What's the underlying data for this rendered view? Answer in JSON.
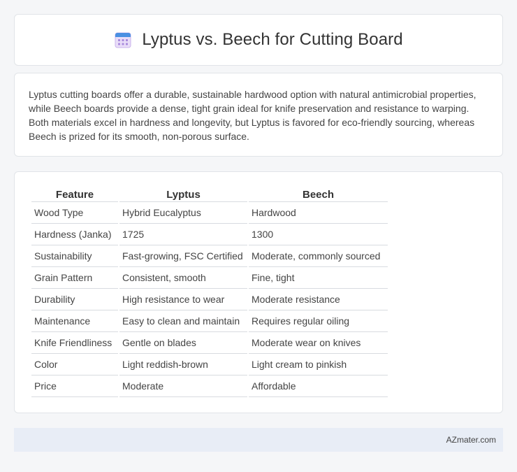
{
  "header": {
    "title": "Lyptus vs. Beech for Cutting Board",
    "icon": "calendar-icon"
  },
  "summary": {
    "text": "Lyptus cutting boards offer a durable, sustainable hardwood option with natural antimicrobial properties, while Beech boards provide a dense, tight grain ideal for knife preservation and resistance to warping. Both materials excel in hardness and longevity, but Lyptus is favored for eco-friendly sourcing, whereas Beech is prized for its smooth, non-porous surface."
  },
  "table": {
    "headers": [
      "Feature",
      "Lyptus",
      "Beech"
    ],
    "rows": [
      [
        "Wood Type",
        "Hybrid Eucalyptus",
        "Hardwood"
      ],
      [
        "Hardness (Janka)",
        "1725",
        "1300"
      ],
      [
        "Sustainability",
        "Fast-growing, FSC Certified",
        "Moderate, commonly sourced"
      ],
      [
        "Grain Pattern",
        "Consistent, smooth",
        "Fine, tight"
      ],
      [
        "Durability",
        "High resistance to wear",
        "Moderate resistance"
      ],
      [
        "Maintenance",
        "Easy to clean and maintain",
        "Requires regular oiling"
      ],
      [
        "Knife Friendliness",
        "Gentle on blades",
        "Moderate wear on knives"
      ],
      [
        "Color",
        "Light reddish-brown",
        "Light cream to pinkish"
      ],
      [
        "Price",
        "Moderate",
        "Affordable"
      ]
    ]
  },
  "footer": {
    "text": "AZmater.com"
  },
  "colors": {
    "background": "#f5f6f8",
    "card": "#ffffff",
    "footer": "#e8edf6",
    "icon_blue": "#4a90e2",
    "icon_purple": "#b08de0"
  }
}
